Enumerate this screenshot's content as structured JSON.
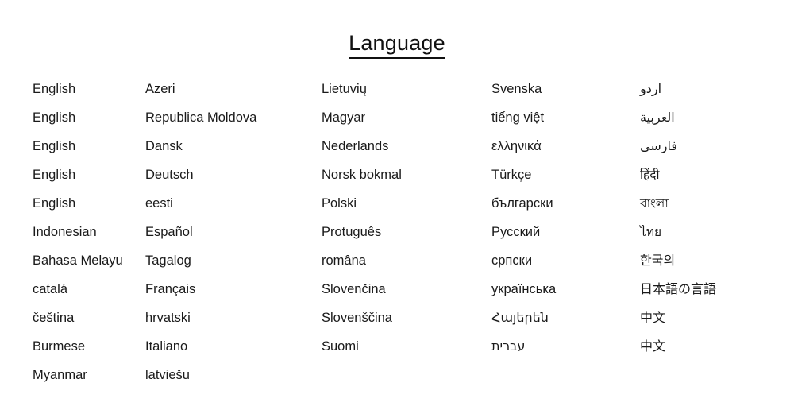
{
  "header": {
    "title": "Language"
  },
  "colors": {
    "background": "#ffffff",
    "text": "#1a1a1a",
    "title_text": "#111111",
    "underline": "#111111"
  },
  "language_list": {
    "columns": [
      {
        "index": 0,
        "items": [
          {
            "label": "English"
          },
          {
            "label": "English"
          },
          {
            "label": "English"
          },
          {
            "label": "English"
          },
          {
            "label": "English"
          },
          {
            "label": "Indonesian"
          },
          {
            "label": "Bahasa Melayu"
          },
          {
            "label": "catalá"
          },
          {
            "label": "čeština"
          },
          {
            "label": "Burmese"
          },
          {
            "label": "Myanmar"
          }
        ]
      },
      {
        "index": 1,
        "items": [
          {
            "label": "Azeri"
          },
          {
            "label": "Republica Moldova"
          },
          {
            "label": "Dansk"
          },
          {
            "label": "Deutsch"
          },
          {
            "label": "eesti"
          },
          {
            "label": "Español"
          },
          {
            "label": "Tagalog"
          },
          {
            "label": "Français"
          },
          {
            "label": "hrvatski"
          },
          {
            "label": "Italiano"
          },
          {
            "label": "latviešu"
          }
        ]
      },
      {
        "index": 2,
        "items": [
          {
            "label": "Lietuvių"
          },
          {
            "label": "Magyar"
          },
          {
            "label": "Nederlands"
          },
          {
            "label": "Norsk bokmal"
          },
          {
            "label": "Polski"
          },
          {
            "label": "Protuguês"
          },
          {
            "label": "româna"
          },
          {
            "label": "Slovenčina"
          },
          {
            "label": "Slovenščina"
          },
          {
            "label": "Suomi"
          }
        ]
      },
      {
        "index": 3,
        "items": [
          {
            "label": "Svenska"
          },
          {
            "label": "tiếng việt"
          },
          {
            "label": "ελληνικἀ"
          },
          {
            "label": "Türkçe"
          },
          {
            "label": "български"
          },
          {
            "label": "Русский"
          },
          {
            "label": "српски"
          },
          {
            "label": "українська"
          },
          {
            "label": "Հայերեն"
          },
          {
            "label": "עברית"
          }
        ]
      },
      {
        "index": 4,
        "items": [
          {
            "label": "اردو"
          },
          {
            "label": "العربية"
          },
          {
            "label": "فارسی"
          },
          {
            "label": "हिंदी"
          },
          {
            "label": "বাংলা"
          },
          {
            "label": "ไทย"
          },
          {
            "label": "한국의"
          },
          {
            "label": "日本語の言語"
          },
          {
            "label": "中文"
          },
          {
            "label": "中文"
          }
        ]
      }
    ]
  }
}
